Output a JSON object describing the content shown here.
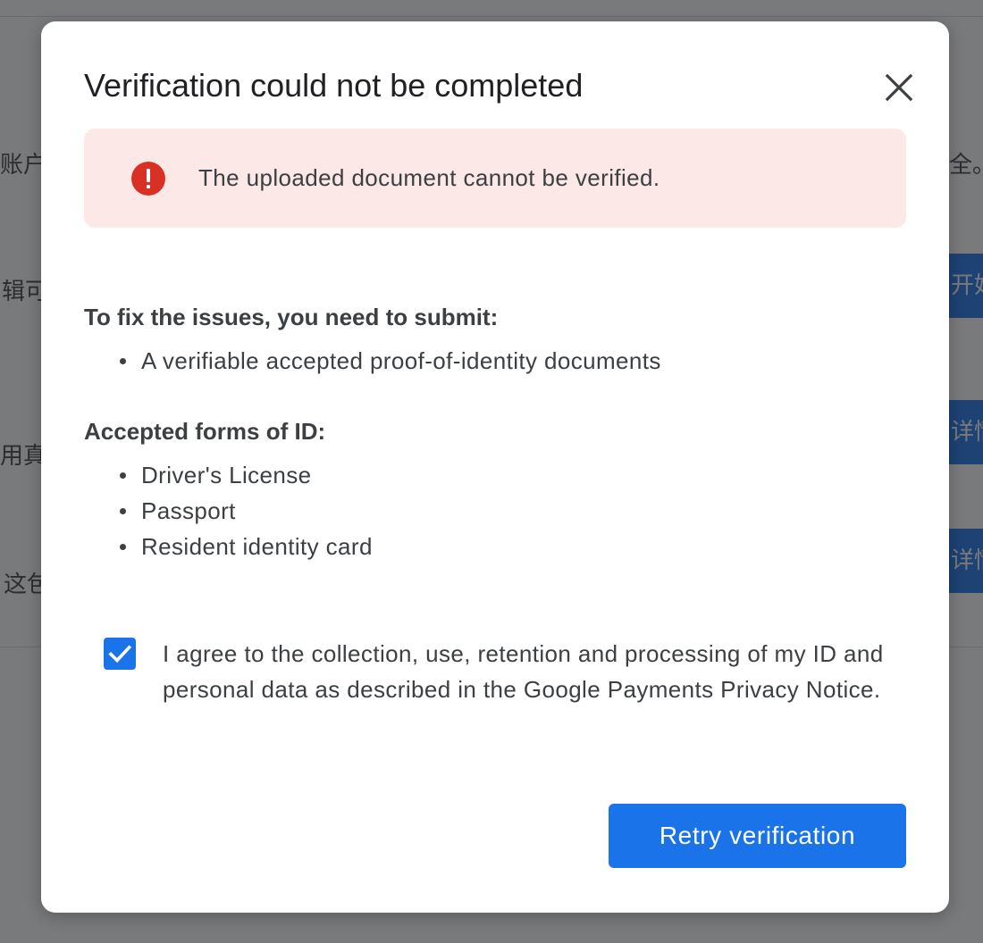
{
  "background": {
    "texts": [
      "账户",
      "辑可",
      "用真",
      "这包"
    ],
    "right_texts": [
      "全。"
    ],
    "buttons": [
      "开始",
      "详情",
      "详情"
    ]
  },
  "dialog": {
    "title": "Verification could not be completed",
    "close_icon": "close-icon",
    "error_banner": {
      "icon": "error-icon",
      "icon_color": "#d93025",
      "background_color": "#fce8e6",
      "message": "The uploaded document cannot be verified."
    },
    "fix_section": {
      "heading": "To fix the issues, you need to submit:",
      "items": [
        "A verifiable accepted proof-of-identity documents"
      ]
    },
    "id_section": {
      "heading": "Accepted forms of ID:",
      "items": [
        "Driver's License",
        "Passport",
        "Resident identity card"
      ]
    },
    "consent": {
      "checked": true,
      "text": "I agree to the collection, use, retention and processing of my ID and personal data as described in the Google Payments Privacy Notice."
    },
    "retry_button": {
      "label": "Retry verification",
      "color": "#1a73e8"
    }
  }
}
